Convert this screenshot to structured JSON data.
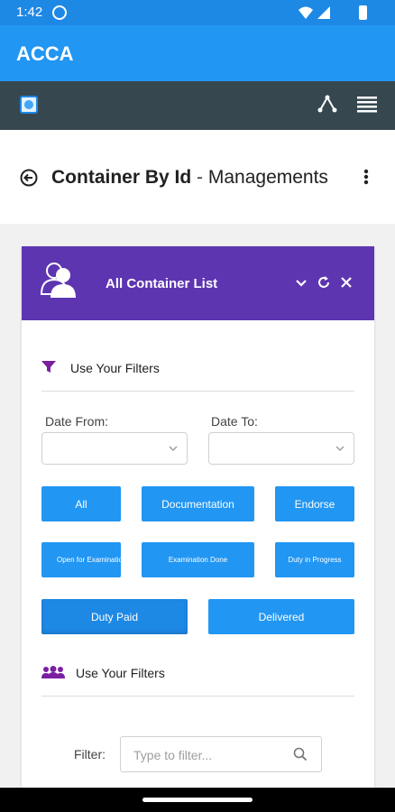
{
  "status_bar": {
    "time": "1:42",
    "icons": [
      "circle-app-icon",
      "wifi-icon",
      "signal-icon",
      "battery-icon"
    ]
  },
  "app_bar": {
    "title": "ACCA"
  },
  "toolbar": {
    "icons": [
      "app-logo-icon",
      "share-network-icon",
      "menu-lines-icon"
    ]
  },
  "page_header": {
    "title": "Container By Id",
    "separator": " - ",
    "subtitle": "Managements"
  },
  "card": {
    "title": "All Container List",
    "color": "#5e35b1",
    "section1": {
      "label": "Use Your Filters",
      "icon": "funnel-icon"
    },
    "date_from": {
      "label": "Date From:",
      "value": ""
    },
    "date_to": {
      "label": "Date To:",
      "value": ""
    },
    "buttons": [
      {
        "label": "All"
      },
      {
        "label": "Documentation"
      },
      {
        "label": "Endorse"
      },
      {
        "label": "Open for Examination"
      },
      {
        "label": "Examination Done"
      },
      {
        "label": "Duty in Progress"
      },
      {
        "label": "Duty Paid"
      },
      {
        "label": "Delivered"
      }
    ],
    "section2": {
      "label": "Use Your Filters",
      "icon": "users-group-icon"
    },
    "filter": {
      "label": "Filter:",
      "placeholder": "Type to filter...",
      "value": ""
    }
  },
  "colors": {
    "primary": "#2196f3",
    "status_bar": "#1e88e5",
    "toolbar": "#37474f",
    "accent_purple": "#5e35b1",
    "icon_purple": "#7b1fa2"
  }
}
